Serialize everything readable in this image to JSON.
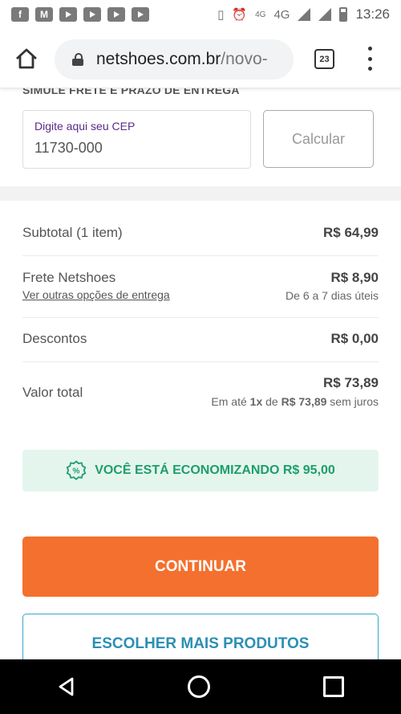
{
  "status_bar": {
    "time": "13:26",
    "network_4g_small": "4G",
    "network_4g": "4G",
    "left_icons": [
      "facebook-icon",
      "gmail-icon",
      "youtube-icon",
      "youtube-icon",
      "youtube-icon",
      "youtube-icon"
    ]
  },
  "browser": {
    "url_domain": "netshoes.com.br",
    "url_path": "/novo-",
    "tab_count": "23"
  },
  "shipping": {
    "section_title": "SIMULE FRETE E PRAZO DE ENTREGA",
    "cep_label": "Digite aqui seu CEP",
    "cep_value": "11730-000",
    "calc_label": "Calcular"
  },
  "summary": {
    "subtotal_label": "Subtotal (1 item)",
    "subtotal_value": "R$ 64,99",
    "freight_label": "Frete Netshoes",
    "freight_value": "R$ 8,90",
    "freight_link": "Ver outras opções de entrega",
    "freight_deadline": "De 6 a 7 dias úteis",
    "discount_label": "Descontos",
    "discount_value": "R$ 0,00",
    "total_label": "Valor total",
    "total_value": "R$ 73,89",
    "installment_prefix": "Em até ",
    "installment_count": "1x",
    "installment_mid": " de ",
    "installment_value": "R$ 73,89",
    "installment_suffix": " sem juros"
  },
  "savings": {
    "text": "VOCÊ ESTÁ ECONOMIZANDO R$ 95,00",
    "icon": "percent-badge-icon"
  },
  "actions": {
    "continue_label": "CONTINUAR",
    "more_products_label": "ESCOLHER MAIS PRODUTOS"
  },
  "colors": {
    "accent_orange": "#f4702e",
    "savings_green": "#1f9d6c",
    "savings_bg": "#e4f5ee",
    "secondary_blue": "#2b8fb4",
    "label_purple": "#5b2a86"
  }
}
